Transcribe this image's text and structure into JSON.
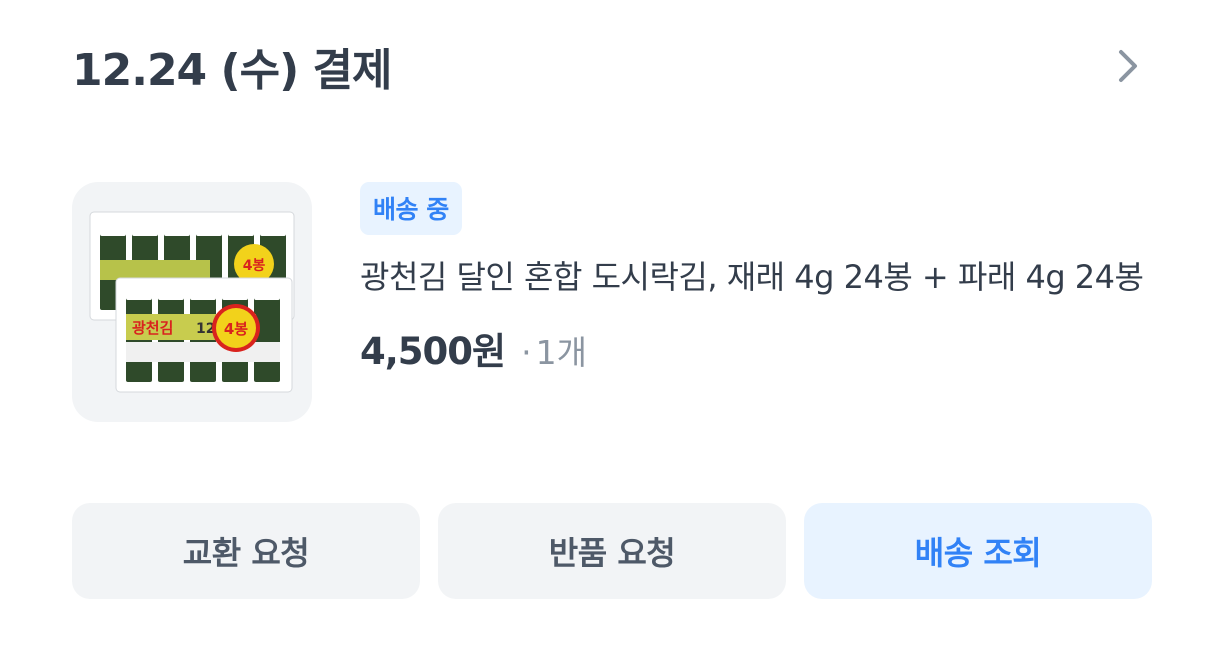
{
  "order": {
    "date_title": "12.24 (수) 결제"
  },
  "product": {
    "status_badge": "배송 중",
    "name": "광천김 달인 혼합 도시락김, 재래 4g 24봉 + 파래 4g 24봉",
    "price": "4,500원",
    "quantity_dot": "·",
    "quantity": "1개",
    "image_icon": "seaweed-product-image",
    "thumbnail_text": [
      "광천김",
      "4봉",
      "12+",
      "4봉"
    ]
  },
  "actions": {
    "exchange_label": "교환 요청",
    "return_label": "반품 요청",
    "track_label": "배송 조회"
  },
  "colors": {
    "accent": "#3182f6",
    "accent_bg": "#e8f3ff",
    "button_bg": "#f2f4f6",
    "text_primary": "#333d4b",
    "text_secondary": "#8b95a1"
  }
}
